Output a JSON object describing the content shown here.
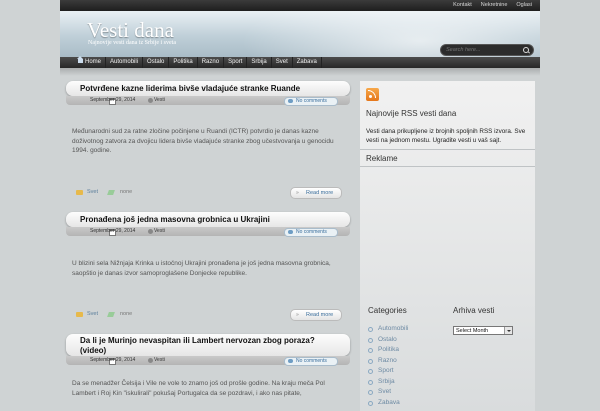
{
  "top_links": [
    "Kontakt",
    "Nekretnine",
    "Oglasi"
  ],
  "header": {
    "title": "Vesti dana",
    "tagline": "Najnovije vesti dana iz Srbije i sveta",
    "search_placeholder": "Search here..."
  },
  "nav": [
    "Home",
    "Automobili",
    "Ostalo",
    "Politika",
    "Razno",
    "Sport",
    "Srbija",
    "Svet",
    "Zabava"
  ],
  "posts": [
    {
      "title": "Potvrđene kazne liderima bivše vladajuće stranke Ruande",
      "date": "September 29, 2014",
      "category": "Vesti",
      "comments": "No comments",
      "excerpt": "Međunarodni sud za ratne zločine počinjene u Ruandi (ICTR) potvrdio je danas kazne doživotnog zatvora za dvojicu lidera bivše vladajuće stranke zbog učestvovanja u genocidu 1994. godine.",
      "footer_category": "Svet",
      "tags": "none",
      "read_more": "Read more"
    },
    {
      "title": "Pronađena još jedna masovna grobnica u Ukrajini",
      "date": "September 29, 2014",
      "category": "Vesti",
      "comments": "No comments",
      "excerpt": "U blizini sela Nižnjaja Krinka u istočnoj Ukrajini pronađena je još jedna masovna grobnica, saopštio je danas izvor samoproglašene Donjecke republike.",
      "footer_category": "Svet",
      "tags": "none",
      "read_more": "Read more"
    },
    {
      "title": "Da li je Murinjo nevaspitan ili Lambert nervozan zbog poraza? (video)",
      "date": "September 29, 2014",
      "category": "Vesti",
      "comments": "No comments",
      "excerpt": "Da se menadžer Čelsija i Vile ne vole to znamo još od prošle godine. Na kraju meča Pol Lambert i Roj Kin \"iskulirali\" pokušaj Portugalca da se pozdravi, i ako nas pitate,"
    }
  ],
  "sidebar": {
    "rss_heading": "Najnovije RSS vesti dana",
    "rss_text": "Vesti dana prikupljene iz brojnih spoljnih RSS izvora. Sve vesti na jednom mestu. Ugradite vesti u vaš sajt.",
    "ads_heading": "Reklame",
    "categories_heading": "Categories",
    "categories": [
      "Automobili",
      "Ostalo",
      "Politika",
      "Razno",
      "Sport",
      "Srbija",
      "Svet",
      "Zabava"
    ],
    "archive_heading": "Arhiva vesti",
    "archive_select": "Select Month"
  },
  "colors": {
    "accent": "#6d8aa3",
    "link": "#3b6f9d",
    "rss": "#e5771b"
  }
}
